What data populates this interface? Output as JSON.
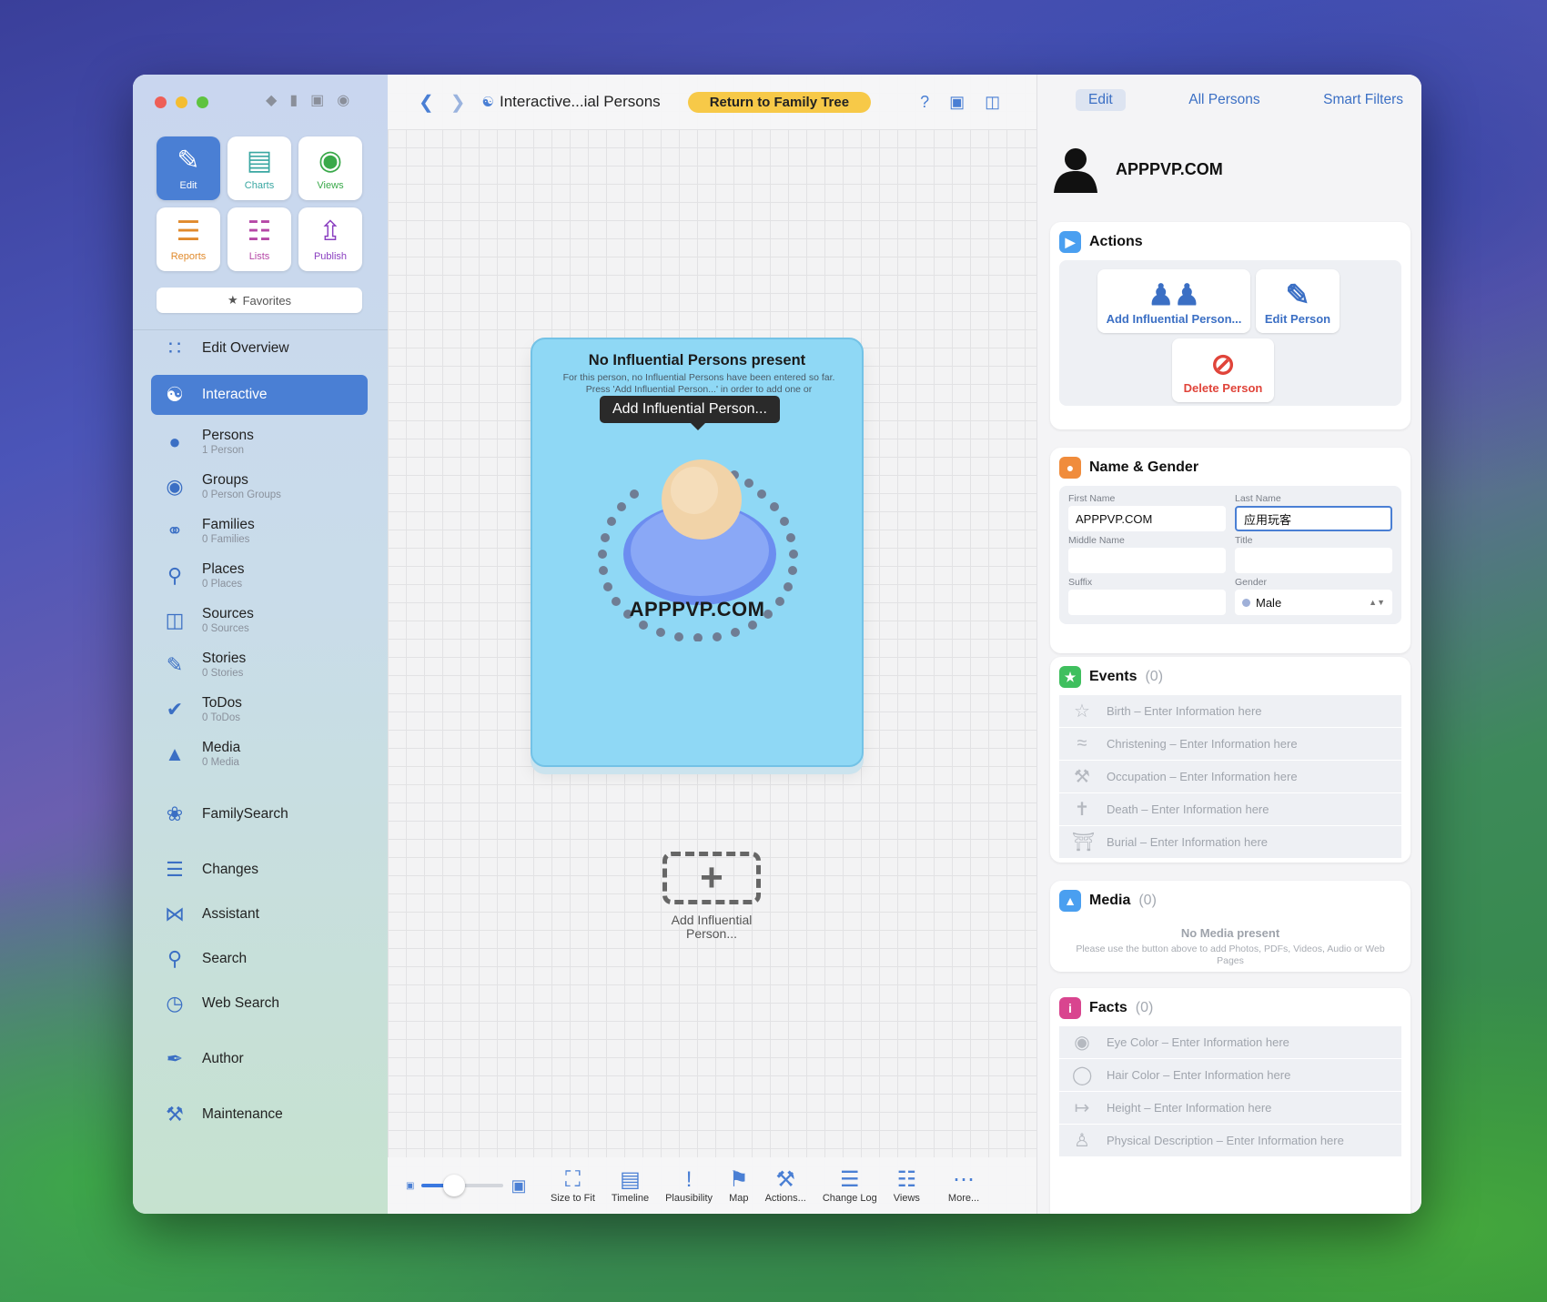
{
  "sidebar": {
    "tiles": [
      {
        "label": "Edit",
        "icon": "pencil-icon",
        "color": "#4a7fd4"
      },
      {
        "label": "Charts",
        "icon": "chart-icon",
        "color": "#3aa7a2"
      },
      {
        "label": "Views",
        "icon": "eye-icon",
        "color": "#3aa94a"
      },
      {
        "label": "Reports",
        "icon": "report-icon",
        "color": "#e08a2c"
      },
      {
        "label": "Lists",
        "icon": "list-icon",
        "color": "#b548a6"
      },
      {
        "label": "Publish",
        "icon": "publish-icon",
        "color": "#8a3fc0"
      }
    ],
    "favorites": "Favorites",
    "items": [
      {
        "label": "Edit Overview",
        "sub": ""
      },
      {
        "label": "Interactive",
        "sub": ""
      },
      {
        "label": "Persons",
        "sub": "1 Person"
      },
      {
        "label": "Groups",
        "sub": "0 Person Groups"
      },
      {
        "label": "Families",
        "sub": "0 Families"
      },
      {
        "label": "Places",
        "sub": "0 Places"
      },
      {
        "label": "Sources",
        "sub": "0 Sources"
      },
      {
        "label": "Stories",
        "sub": "0 Stories"
      },
      {
        "label": "ToDos",
        "sub": "0 ToDos"
      },
      {
        "label": "Media",
        "sub": "0 Media"
      },
      {
        "label": "FamilySearch",
        "sub": ""
      },
      {
        "label": "Changes",
        "sub": ""
      },
      {
        "label": "Assistant",
        "sub": ""
      },
      {
        "label": "Search",
        "sub": ""
      },
      {
        "label": "Web Search",
        "sub": ""
      },
      {
        "label": "Author",
        "sub": ""
      },
      {
        "label": "Maintenance",
        "sub": ""
      }
    ]
  },
  "canvas": {
    "breadcrumb": "Interactive...ial Persons",
    "return_label": "Return to Family Tree",
    "card": {
      "title": "No Influential Persons present",
      "desc": "For this person, no Influential Persons have been entered so far. Press 'Add Influential Person...' in order to add one or",
      "tooltip": "Add Influential Person...",
      "name": "APPPVP.COM"
    },
    "add_label": "Add Influential Person...",
    "toolbar": [
      "Size to Fit",
      "Timeline",
      "Plausibility",
      "Map",
      "Actions...",
      "Change Log",
      "Views",
      "More..."
    ],
    "zoom_level": 0.4
  },
  "inspector": {
    "tabs": [
      "Edit",
      "All Persons",
      "Smart Filters"
    ],
    "person_name": "APPPVP.COM",
    "actions": {
      "title": "Actions",
      "add_influential": "Add Influential Person...",
      "edit_person": "Edit Person",
      "delete_person": "Delete Person"
    },
    "name_gender": {
      "title": "Name & Gender",
      "first_name_label": "First Name",
      "first_name": "APPPVP.COM",
      "last_name_label": "Last Name",
      "last_name": "应用玩客",
      "middle_name_label": "Middle Name",
      "middle_name": "",
      "title_label": "Title",
      "title_value": "",
      "suffix_label": "Suffix",
      "suffix": "",
      "gender_label": "Gender",
      "gender": "Male"
    },
    "events": {
      "title": "Events",
      "count": "(0)",
      "rows": [
        "Birth – Enter Information here",
        "Christening – Enter Information here",
        "Occupation – Enter Information here",
        "Death – Enter Information here",
        "Burial – Enter Information here"
      ]
    },
    "media": {
      "title": "Media",
      "count": "(0)",
      "empty_title": "No Media present",
      "empty_desc": "Please use the button above to add Photos, PDFs, Videos, Audio or Web Pages"
    },
    "facts": {
      "title": "Facts",
      "count": "(0)",
      "rows": [
        "Eye Color – Enter Information here",
        "Hair Color – Enter Information here",
        "Height – Enter Information here",
        "Physical Description – Enter Information here"
      ]
    }
  },
  "colors": {
    "accent": "#4a7fd4",
    "return_button": "#f7c948",
    "card": "#8fd8f5",
    "delete": "#e0443a"
  }
}
